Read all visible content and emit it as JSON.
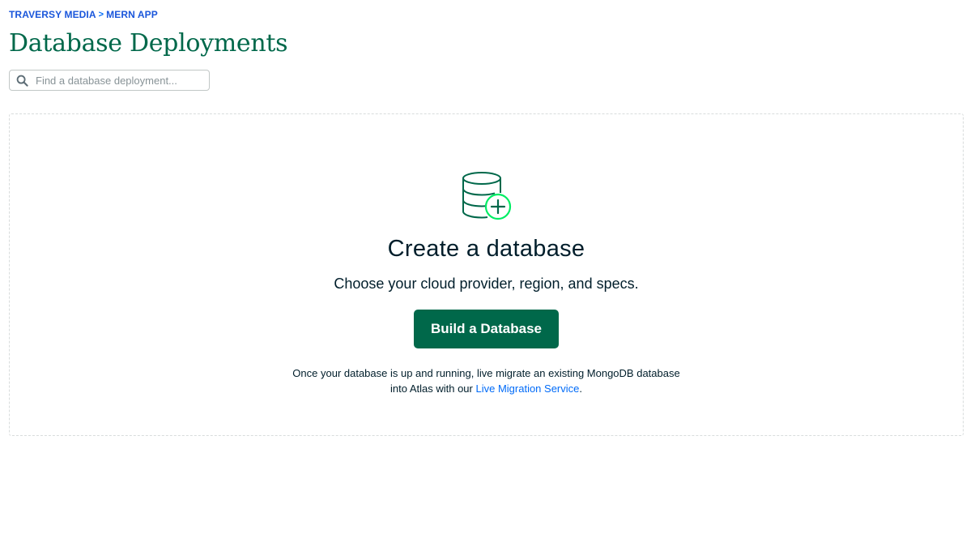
{
  "breadcrumb": {
    "org": "TRAVERSY MEDIA",
    "separator": ">",
    "project": "MERN APP"
  },
  "page": {
    "title": "Database Deployments"
  },
  "search": {
    "placeholder": "Find a database deployment..."
  },
  "empty_state": {
    "title": "Create a database",
    "subtitle": "Choose your cloud provider, region, and specs.",
    "button_label": "Build a Database",
    "migrate_line1": "Once your database is up and running, live migrate an existing MongoDB database",
    "migrate_line2_prefix": "into Atlas with our ",
    "migrate_link": "Live Migration Service",
    "migrate_line2_suffix": "."
  },
  "icons": {
    "search": "search-icon",
    "database_add": "database-add-icon"
  },
  "colors": {
    "brand_green": "#00684a",
    "link_blue": "#016bf8",
    "accent_green": "#00ed64",
    "text_dark": "#001e2b"
  }
}
